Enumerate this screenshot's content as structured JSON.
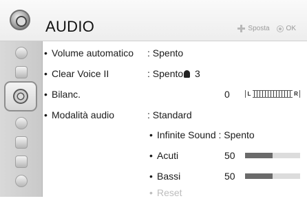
{
  "header": {
    "title": "AUDIO",
    "hint_move": "Sposta",
    "hint_ok": "OK"
  },
  "sidebar": {
    "items": [
      {
        "icon": "picture-icon"
      },
      {
        "icon": "screen-icon"
      },
      {
        "icon": "audio-icon",
        "active": true
      },
      {
        "icon": "clock-icon"
      },
      {
        "icon": "lock-icon"
      },
      {
        "icon": "options-icon"
      },
      {
        "icon": "network-icon"
      }
    ]
  },
  "audio": {
    "bullet": "•",
    "volume_auto": {
      "label": "Volume automatico",
      "value": ": Spento"
    },
    "clear_voice": {
      "label": "Clear Voice II",
      "value": ": Spento",
      "level": "3"
    },
    "balance": {
      "label": "Bilanc.",
      "value": "0",
      "left": "L",
      "right": "R"
    },
    "sound_mode": {
      "label": "Modalità audio",
      "value": ": Standard"
    },
    "infinite_sound": {
      "label": "Infinite Sound : Spento"
    },
    "treble": {
      "label": "Acuti",
      "value": "50",
      "level": 0.5
    },
    "bass": {
      "label": "Bassi",
      "value": "50",
      "level": 0.5
    },
    "reset": {
      "label": "Reset"
    }
  }
}
